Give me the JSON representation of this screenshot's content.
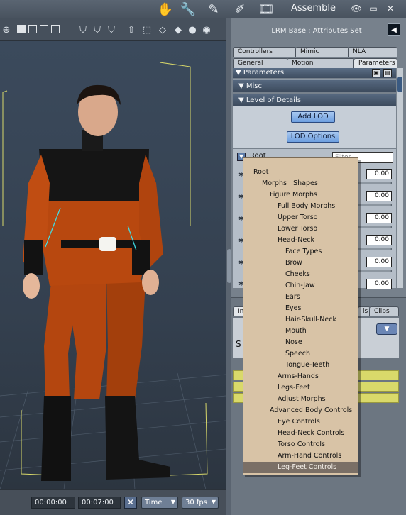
{
  "window": {
    "room_title": "Assemble",
    "tools": [
      {
        "name": "hand-tool-icon",
        "glyph": "✋"
      },
      {
        "name": "wrench-tool-icon",
        "glyph": "🔧"
      },
      {
        "name": "pen-tool-icon",
        "glyph": "✎"
      },
      {
        "name": "brush-tool-icon",
        "glyph": "✐"
      },
      {
        "name": "film-tool-icon",
        "glyph": "🎞"
      }
    ],
    "controls": {
      "eye": "👁",
      "restore": "▭",
      "close": "✕"
    }
  },
  "viewport": {
    "toolbar_icons": [
      "crosshair-icon",
      "layout-single-icon",
      "layout-dual-icon",
      "layout-quad-icon",
      "layout-custom-icon",
      "shield-a-icon",
      "shield-b-icon",
      "shield-c-icon",
      "up-arrow-icon",
      "bounds-icon",
      "cube-icon",
      "solid-cube-icon",
      "sphere-grey-icon",
      "sphere-light-icon"
    ]
  },
  "timeline": {
    "current_time": "00:00:00",
    "end_time": "00:07:00",
    "mode": "Time",
    "fps": "30 fps"
  },
  "panel": {
    "title": "LRM Base : Attributes Set",
    "tabs_row1": [
      "Controllers",
      "Mimic",
      "NLA"
    ],
    "tabs_row2": [
      "General",
      "Motion",
      "Parameters"
    ],
    "active_tab": "Parameters",
    "parameters_header": "Parameters",
    "sections": [
      "Misc",
      "Level of Details"
    ],
    "buttons": {
      "add_lod": "Add LOD",
      "lod_options": "LOD Options"
    },
    "dropdown_current": "Root",
    "filter_placeholder": "Filter",
    "values": [
      "0.00",
      "0.00",
      "0.00",
      "0.00",
      "0.00",
      "0.00"
    ],
    "lower_tabs": [
      "In",
      "ls",
      "Clips"
    ],
    "lower_section_letter": "S"
  },
  "menu": {
    "highlighted": "Leg-Feet Controls",
    "items": [
      {
        "label": "Root",
        "level": 0
      },
      {
        "label": "Morphs | Shapes",
        "level": 1
      },
      {
        "label": "Figure Morphs",
        "level": 2
      },
      {
        "label": "Full Body Morphs",
        "level": 3
      },
      {
        "label": "Upper Torso",
        "level": 3
      },
      {
        "label": "Lower Torso",
        "level": 3
      },
      {
        "label": "Head-Neck",
        "level": 3
      },
      {
        "label": "Face Types",
        "level": 4
      },
      {
        "label": "Brow",
        "level": 4
      },
      {
        "label": "Cheeks",
        "level": 4
      },
      {
        "label": "Chin-Jaw",
        "level": 4
      },
      {
        "label": "Ears",
        "level": 4
      },
      {
        "label": "Eyes",
        "level": 4
      },
      {
        "label": "Hair-Skull-Neck",
        "level": 4
      },
      {
        "label": "Mouth",
        "level": 4
      },
      {
        "label": "Nose",
        "level": 4
      },
      {
        "label": "Speech",
        "level": 4
      },
      {
        "label": "Tongue-Teeth",
        "level": 4
      },
      {
        "label": "Arms-Hands",
        "level": 3
      },
      {
        "label": "Legs-Feet",
        "level": 3
      },
      {
        "label": "Adjust Morphs",
        "level": 3
      },
      {
        "label": "Advanced Body Controls",
        "level": 2
      },
      {
        "label": "Eye Controls",
        "level": 3
      },
      {
        "label": "Head-Neck Controls",
        "level": 3
      },
      {
        "label": "Torso Controls",
        "level": 3
      },
      {
        "label": "Arm-Hand Controls",
        "level": 3
      },
      {
        "label": "Leg-Feet Controls",
        "level": 3
      }
    ]
  }
}
